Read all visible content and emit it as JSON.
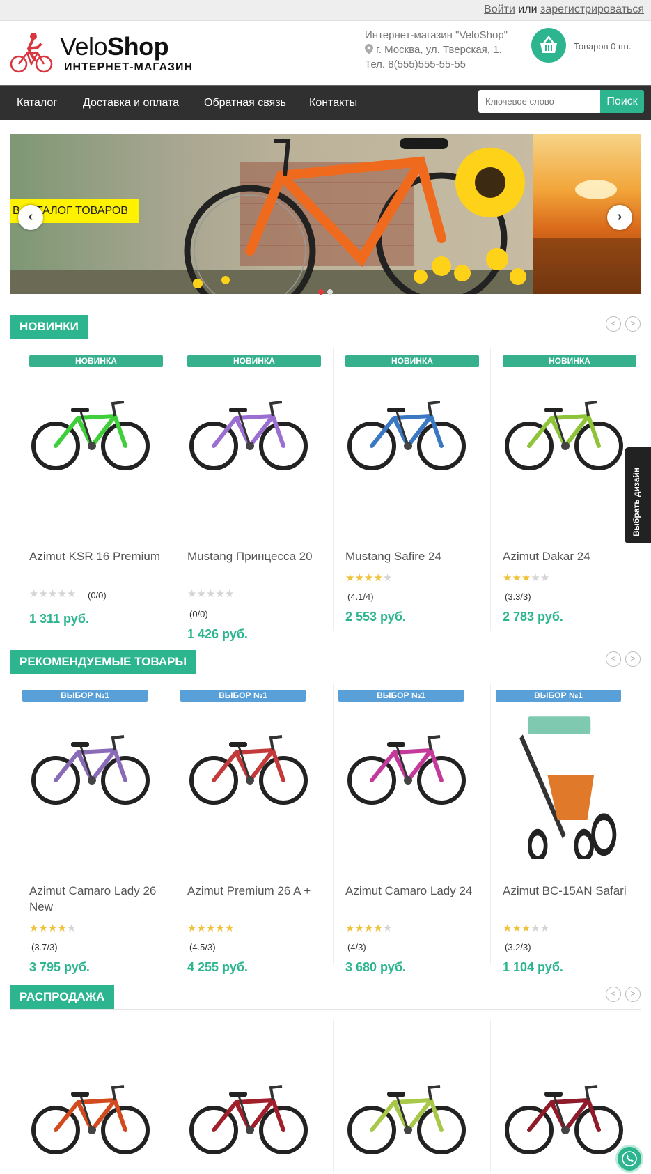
{
  "topbar": {
    "login": "Войти",
    "or": "или",
    "register": "зарегистрироваться"
  },
  "logo": {
    "brand_part1": "Velo",
    "brand_part2": "Shop",
    "subtitle": "ИНТЕРНЕТ-МАГАЗИН"
  },
  "contact": {
    "store": "Интернет-магазин \"VeloShop\"",
    "address": "г. Москва, ул. Тверская, 1.",
    "phone": "Тел. 8(555)555-55-55"
  },
  "cart": {
    "label": "Товаров 0 шт."
  },
  "nav": {
    "items": [
      "Каталог",
      "Доставка и оплата",
      "Обратная связь",
      "Контакты"
    ]
  },
  "search": {
    "placeholder": "Ключевое слово",
    "button": "Поиск"
  },
  "slider": {
    "ribbon": "В КАТАЛОГ ТОВАРОВ",
    "prev": "‹",
    "next": "›"
  },
  "colors": {
    "accent": "#2cb58f",
    "nav_bg": "#303030",
    "ribbon": "#fff200",
    "badge_new": "#36b08d",
    "badge_choice": "#5aa0d8",
    "star": "#f0c23b"
  },
  "sections": {
    "new": {
      "title": "НОВИНКИ",
      "products": [
        {
          "badge": "НОВИНКА",
          "name": "Azimut KSR 16 Premium",
          "rating": "(0/0)",
          "stars": 0,
          "price": "1 311 руб.",
          "bike_color": "#3fcf3a"
        },
        {
          "badge": "НОВИНКА",
          "name": "Mustang Принцесса 20",
          "rating": "(0/0)",
          "stars": 0,
          "price": "1 426 руб.",
          "bike_color": "#9b6fd1"
        },
        {
          "badge": "НОВИНКА",
          "name": "Mustang Safire 24",
          "rating": "(4.1/4)",
          "stars": 4,
          "price": "2 553 руб.",
          "bike_color": "#3a78c4"
        },
        {
          "badge": "НОВИНКА",
          "name": "Azimut Dakar 24",
          "rating": "(3.3/3)",
          "stars": 3,
          "price": "2 783 руб.",
          "bike_color": "#8fc43a"
        }
      ]
    },
    "recommended": {
      "title": "РЕКОМЕНДУЕМЫЕ ТОВАРЫ",
      "products": [
        {
          "badge": "ВЫБОР №1",
          "name": "Azimut Camaro Lady 26 New",
          "rating": "(3.7/3)",
          "stars": 4,
          "price": "3 795 руб.",
          "bike_color": "#8a6bb8"
        },
        {
          "badge": "ВЫБОР №1",
          "name": "Azimut Premium 26 A +",
          "rating": "(4.5/3)",
          "stars": 4.5,
          "price": "4 255 руб.",
          "bike_color": "#c43a3a"
        },
        {
          "badge": "ВЫБОР №1",
          "name": "Azimut Camaro Lady 24",
          "rating": "(4/3)",
          "stars": 4,
          "price": "3 680 руб.",
          "bike_color": "#c43a9b"
        },
        {
          "badge": "ВЫБОР №1",
          "name": "Azimut BC-15AN Safari",
          "rating": "(3.2/3)",
          "stars": 3,
          "price": "1 104 руб.",
          "bike_color": "#e07a2a"
        }
      ]
    },
    "sale": {
      "title": "РАСПРОДАЖА",
      "products": [
        {
          "bike_color": "#d24a1e"
        },
        {
          "bike_color": "#a11f2a"
        },
        {
          "bike_color": "#a8c84a"
        },
        {
          "bike_color": "#8e1a2a"
        }
      ]
    }
  },
  "side_tab": {
    "label": "Выбрать дизайн"
  }
}
